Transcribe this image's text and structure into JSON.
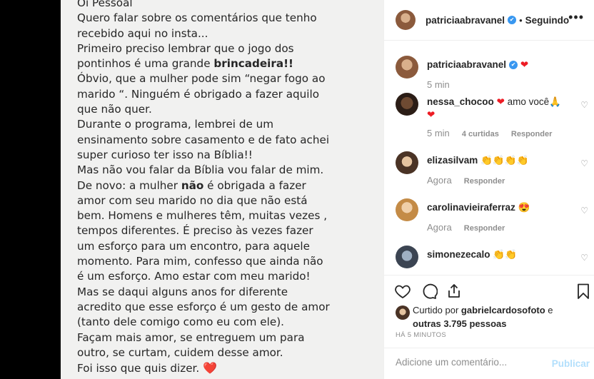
{
  "post": {
    "lines": [
      {
        "parts": [
          {
            "t": "Oi Pessoal"
          }
        ]
      },
      {
        "parts": [
          {
            "t": "Quero falar sobre os comentários que tenho"
          }
        ]
      },
      {
        "parts": [
          {
            "t": "recebido aqui no insta..."
          }
        ]
      },
      {
        "parts": [
          {
            "t": "Primeiro preciso lembrar que o jogo dos"
          }
        ]
      },
      {
        "parts": [
          {
            "t": "pontinhos é uma grande "
          },
          {
            "t": "brincadeira!!",
            "b": true
          }
        ]
      },
      {
        "parts": [
          {
            "t": "Óbvio, que a mulher pode sim “negar fogo ao"
          }
        ]
      },
      {
        "parts": [
          {
            "t": "marido “. Ninguém é obrigado a fazer aquilo"
          }
        ]
      },
      {
        "parts": [
          {
            "t": "que não quer."
          }
        ]
      },
      {
        "parts": [
          {
            "t": "Durante o programa, lembrei de um"
          }
        ]
      },
      {
        "parts": [
          {
            "t": "ensinamento sobre casamento e de fato achei"
          }
        ]
      },
      {
        "parts": [
          {
            "t": "super curioso ter isso na Bíblia!!"
          }
        ]
      },
      {
        "parts": [
          {
            "t": "Mas não vou falar da Bíblia vou falar de mim."
          }
        ]
      },
      {
        "parts": [
          {
            "t": "De novo: a mulher "
          },
          {
            "t": "não",
            "b": true
          },
          {
            "t": " é obrigada a fazer"
          }
        ]
      },
      {
        "parts": [
          {
            "t": "amor com seu marido no dia que não está"
          }
        ]
      },
      {
        "parts": [
          {
            "t": "bem. Homens e mulheres têm, muitas vezes ,"
          }
        ]
      },
      {
        "parts": [
          {
            "t": "tempos diferentes. É preciso às vezes fazer"
          }
        ]
      },
      {
        "parts": [
          {
            "t": "um esforço para um encontro, para aquele"
          }
        ]
      },
      {
        "parts": [
          {
            "t": "momento. Para mim, confesso que ainda não"
          }
        ]
      },
      {
        "parts": [
          {
            "t": "é um esforço. Amo estar com meu marido!"
          }
        ]
      },
      {
        "parts": [
          {
            "t": "Mas se daqui alguns anos for diferente"
          }
        ]
      },
      {
        "parts": [
          {
            "t": "acredito que esse esforço é um gesto de amor"
          }
        ]
      },
      {
        "parts": [
          {
            "t": "(tanto dele comigo como eu com ele)."
          }
        ]
      },
      {
        "parts": [
          {
            "t": "Façam mais amor, se entreguem um para"
          }
        ]
      },
      {
        "parts": [
          {
            "t": "outro, se curtam, cuidem desse amor."
          }
        ]
      },
      {
        "parts": [
          {
            "t": "Foi isso que quis dizer. "
          },
          {
            "t": "❤️",
            "heart": true
          }
        ]
      }
    ]
  },
  "header": {
    "username": "patriciaabravanel",
    "verified_mark": "✔",
    "separator": "•",
    "follow_label": "Seguindo",
    "more_label": "•••"
  },
  "caption": {
    "username": "patriciaabravanel",
    "text": "❤",
    "time": "5 min"
  },
  "comments": [
    {
      "username": "nessa_chocoo",
      "text_a": "❤",
      "text_b": " amo você🙏",
      "text_c": "❤",
      "time": "5 min",
      "likes": "4 curtidas",
      "reply": "Responder"
    },
    {
      "username": "elizasilvam",
      "text_a": "👏👏👏👏",
      "time": "Agora",
      "reply": "Responder"
    },
    {
      "username": "carolinavieiraferraz",
      "text_a": "😍",
      "time": "Agora",
      "reply": "Responder"
    },
    {
      "username": "simonezecalo",
      "text_a": "👏👏",
      "time": "",
      "reply": ""
    }
  ],
  "likes": {
    "prefix": "Curtido por ",
    "user": "gabrielcardosofoto",
    "middle": " e",
    "others": "outras 3.795 pessoas"
  },
  "timestamp": "HÁ 5 MINUTOS",
  "add_comment": {
    "placeholder": "Adicione um comentário...",
    "publish_label": "Publicar"
  },
  "icons": {
    "like": "heart-outline-icon",
    "comment": "comment-bubble-icon",
    "share": "share-icon",
    "save": "bookmark-icon"
  },
  "colors": {
    "verified": "#3897f0",
    "heart": "#ed1c24",
    "publish_disabled": "#b2dffc",
    "meta_gray": "#8e8e8e"
  }
}
